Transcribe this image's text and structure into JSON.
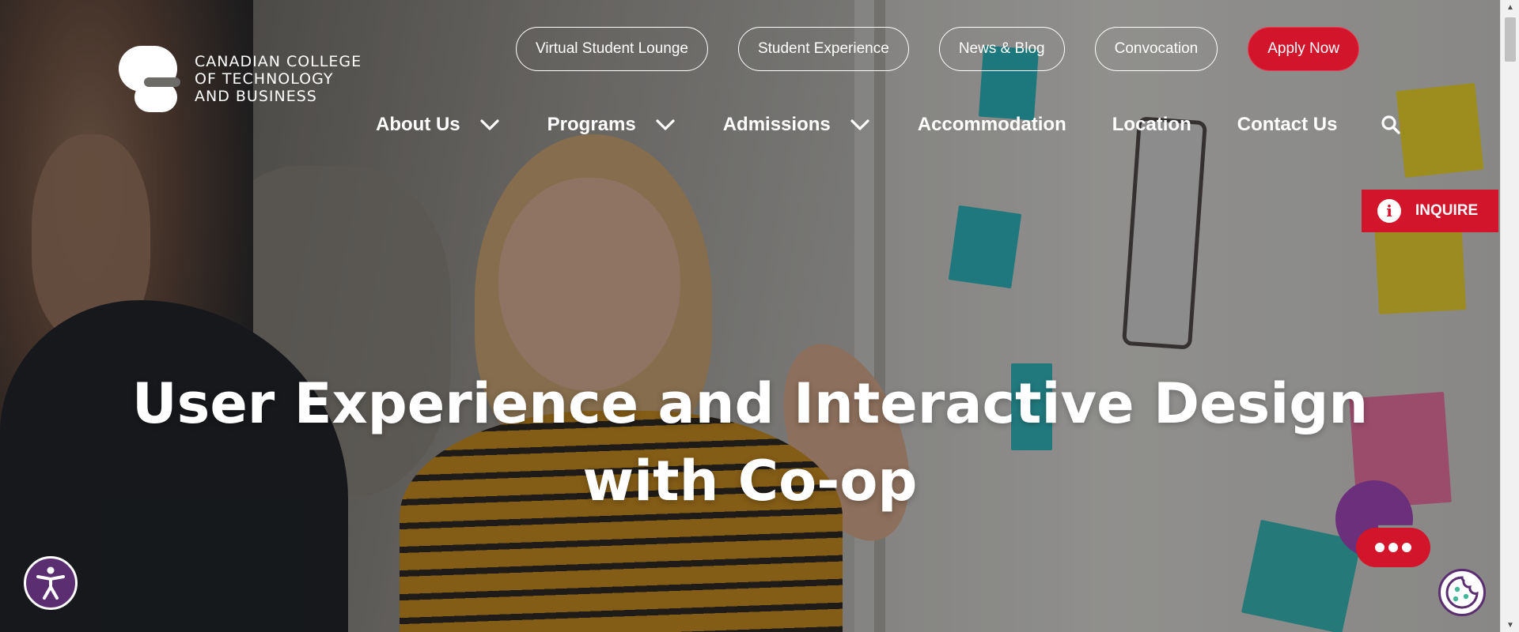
{
  "brand": {
    "logo_lines": [
      "CANADIAN COLLEGE",
      "OF TECHNOLOGY",
      "AND BUSINESS"
    ],
    "accent_color": "#d3152b",
    "secondary_color": "#5b2d71"
  },
  "top_links": [
    {
      "label": "Virtual Student Lounge"
    },
    {
      "label": "Student Experience"
    },
    {
      "label": "News & Blog"
    },
    {
      "label": "Convocation"
    },
    {
      "label": "Apply Now"
    }
  ],
  "main_nav": [
    {
      "label": "About Us",
      "has_dropdown": true
    },
    {
      "label": "Programs",
      "has_dropdown": true
    },
    {
      "label": "Admissions",
      "has_dropdown": true
    },
    {
      "label": "Accommodation",
      "has_dropdown": false
    },
    {
      "label": "Location",
      "has_dropdown": false
    },
    {
      "label": "Contact Us",
      "has_dropdown": false
    }
  ],
  "search": {
    "icon": "search-icon"
  },
  "inquire": {
    "label": "INQUIRE",
    "icon": "info-icon"
  },
  "hero": {
    "title_line1": "User Experience and Interactive Design",
    "title_line2": "with Co-op"
  },
  "widgets": {
    "accessibility_icon": "accessibility-icon",
    "chat_icon": "chat-icon",
    "cookie_icon": "cookie-icon"
  }
}
